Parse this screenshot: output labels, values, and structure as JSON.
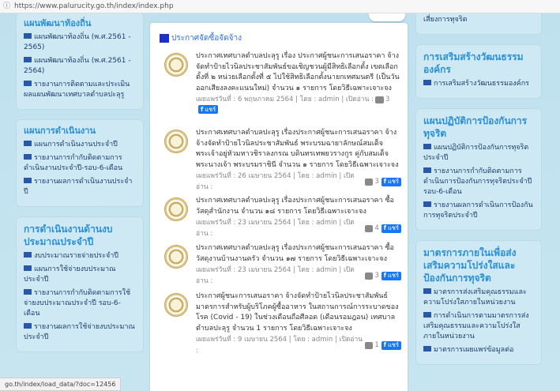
{
  "browser": {
    "url": "https://www.palurucity.go.th/index/index.php",
    "status_url": "go.th/index/load_data/?doc=12456"
  },
  "left": {
    "cards": [
      {
        "title": "แผนพัฒนาท้องถิ่น",
        "links": [
          "แผนพัฒนาท้องถิ่น (พ.ศ.2561 - 2565)",
          "แผนพัฒนาท้องถิ่น (พ.ศ.2561 - 2564)",
          "รายงานการติดตามและประเมินผลแผนพัฒนาเทศบาลตำบลปะลุรู"
        ]
      },
      {
        "title": "แผนการดำเนินงาน",
        "links": [
          "แผนการดำเนินงานประจำปี",
          "รายงานการกำกับติดตามการดำเนินงานประจำปี-รอบ-6-เดือน",
          "รายงานผลการดำเนินงานประจำปี"
        ]
      },
      {
        "title": "การดำเนินงานด้านงบประมาณประจำปี",
        "links": [
          "งบประมาณรายจ่ายประจำปี",
          "แผนการใช้จ่ายงบประมาณประจำปี",
          "รายงานการกำกับติดตามการใช้จ่ายงบประมาณประจำปี รอบ-6-เดือน",
          "รายงานผลการใช้จ่ายงบประมาณประจำปี"
        ]
      }
    ]
  },
  "center": {
    "title": "ประกาศจัดซื้อจัดจ้าง",
    "news": [
      {
        "text": "ประกาศเทศบาลตำบลปะลุรู เรื่อง ประกาศผู้ชนะการเสนอราคา จ้างจัดทำป้ายไวนิลประชาสัมพันธ์ขอเชิญชวนผู้มีสิทธิเลือกตั้ง เขตเลือกตั้งที่ ๒ หน่วยเลือกตั้งที่ ๕ ไปใช้สิทธิเลือกตั้งนายกเทศมนตรี (เป็นวันออกเสียงลงคะแนนใหม่) จำนวน ๑ รายการ โดยวิธีเฉพาะเจาะจง",
        "meta": "เผยแพร่วันที่ : 6 พฤษภาคม 2564 | โดย : admin | เปิดอ่าน :",
        "views": "3",
        "share": "แชร์"
      },
      {
        "text": "ประกาศเทศบาลตำบลปะลุรู เรื่องประกาศผู้ชนะการเสนอราคา จ้างจ้างจัดทำป้ายไวนิลประชาสัมพันธ์ พระบรมฉายาลักษณ์สมเด็จพระเจ้าอยู่หัวมหาวชิราลงกรณ บดินทรเทพยวรางกูร คู่กับสมเด็จพระนางเจ้า พระบรมราชินี จำนวน ๑ รายการ โดยวิธีเฉพาะเจาะจง",
        "meta": "เผยแพร่วันที่ : 26 เมษายน 2564 | โดย : admin | เปิดอ่าน :",
        "views": "3",
        "share": "แชร์"
      },
      {
        "text": "ประกาศเทศบาลตำบลปะลุรู เรื่องประกาศผู้ชนะการเสนอราคา ซื้อวัสดุสำนักงาน จำนวน ๑๘ รายการ โดยวิธีเฉพาะเจาะจง",
        "meta": "เผยแพร่วันที่ : 23 เมษายน 2564 | โดย : admin | เปิดอ่าน :",
        "views": "4",
        "share": "แชร์"
      },
      {
        "text": "ประกาศเทศบาลตำบลปะลุรู เรื่องประกาศผู้ชนะการเสนอราคา ซื้อวัสดุงานบ้านงานครัว จำนวน ๑๗ รายการ โดยวิธีเฉพาะเจาะจง",
        "meta": "เผยแพร่วันที่ : 23 เมษายน 2564 | โดย : admin | เปิดอ่าน :",
        "views": "3",
        "share": "แชร์"
      },
      {
        "text": "ประกาศผู้ชนะการเสนอราคา จ้างจัดทำป้ายไวนิลประชาสัมพันธ์มาตรการสำหรับผู้บริโภคผู้ซื้ออาหาร ในสถานการณ์การระบาดของโรค (Covid - 19) ในช่วงเดือนถือศีลอด (เดือนรอมฎอน) เทศบาลตำบลปะลุรู จำนวน 1 รายการ โดยวิธีเฉพาะเจาะจง",
        "meta": "เผยแพร่วันที่ : 9 เมษายน 2564 | โดย : admin | เปิดอ่าน :",
        "views": "1",
        "share": "แชร์"
      }
    ]
  },
  "right": {
    "top_partial_text": "เสี่ยงการทุจริต",
    "cards": [
      {
        "title": "การเสริมสร้างวัฒนธรรมองค์กร",
        "links": [
          "การเสริมสร้างวัฒนธรรมองค์กร"
        ]
      },
      {
        "title": "แผนปฏิบัติการป้องกันการทุจริต",
        "links": [
          "แผนปฏิบัติการป้องกันการทุจริตประจำปี",
          "รายงานการกำกับติดตามการดำเนินการป้องกันการทุจริตประจำปี รอบ-6-เดือน",
          "รายงานผลการดำเนินการป้องกันการทุจริตประจำปี"
        ]
      },
      {
        "title": "มาตรการภายในเพื่อส่งเสริมความโปร่งใสและป้องกันการทุจริต",
        "links": [
          "มาตรการส่งเสริมคุณธรรมและความโปร่งใสภายในหน่วยงาน",
          "การดำเนินการตามมาตรการส่งเสริมคุณธรรมและความโปร่งใสภายในหน่วยงาน",
          "มาตรการเผยแพร่ข้อมูลต่อ"
        ]
      }
    ]
  },
  "colors": {
    "link_square": "#2a58a8",
    "card_title": "#2a8fd6",
    "page_bg": "#c6e5f0",
    "share_button": "#1877f2"
  }
}
